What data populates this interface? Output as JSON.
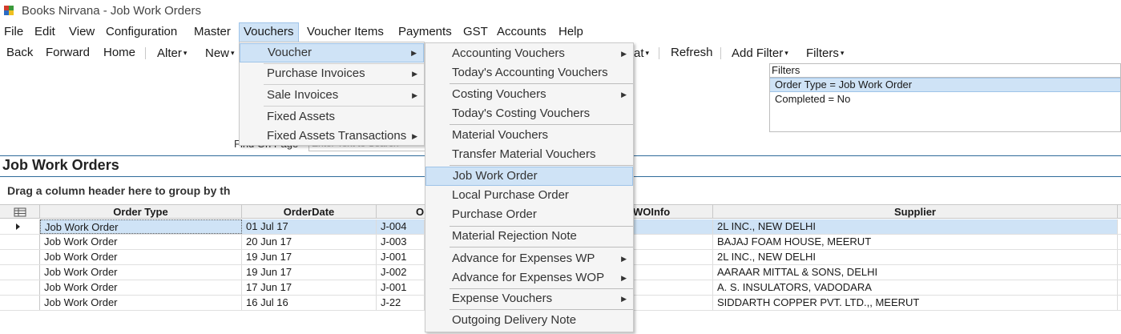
{
  "window": {
    "title": "Books Nirvana - Job Work Orders"
  },
  "menubar": {
    "file": "File",
    "edit": "Edit",
    "view": "View",
    "configuration": "Configuration",
    "master": "Master",
    "vouchers": "Vouchers",
    "voucher_items": "Voucher Items",
    "payments": "Payments",
    "gst": "GST",
    "accounts": "Accounts",
    "help": "Help"
  },
  "toolbar": {
    "back": "Back",
    "forward": "Forward",
    "home": "Home",
    "alter": "Alter",
    "new": "New",
    "format_partial": "at",
    "refresh": "Refresh",
    "add_filter": "Add Filter",
    "filters": "Filters"
  },
  "filters": {
    "label": "Filters",
    "items": [
      "Order Type = Job Work Order",
      "Completed = No"
    ]
  },
  "find": {
    "label": "Find On Page",
    "placeholder": "Enter Text to Search"
  },
  "section": {
    "title": "Job Work Orders",
    "group_hint": "Drag a column header here to group by th"
  },
  "grid": {
    "columns": {
      "order_type": "Order Type",
      "order_date": "OrderDate",
      "order_no": "O",
      "wo_info": "WOInfo",
      "supplier": "Supplier"
    },
    "rows": [
      {
        "order_type": "Job Work Order",
        "order_date": "01 Jul 17",
        "order_no": "J-004",
        "supplier": "2L INC., NEW DELHI"
      },
      {
        "order_type": "Job Work Order",
        "order_date": "20 Jun 17",
        "order_no": "J-003",
        "supplier": "BAJAJ FOAM HOUSE, MEERUT"
      },
      {
        "order_type": "Job Work Order",
        "order_date": "19 Jun 17",
        "order_no": "J-001",
        "supplier": "2L INC., NEW DELHI"
      },
      {
        "order_type": "Job Work Order",
        "order_date": "19 Jun 17",
        "order_no": "J-002",
        "supplier": "AARAAR MITTAL & SONS, DELHI"
      },
      {
        "order_type": "Job Work Order",
        "order_date": "17 Jun 17",
        "order_no": "J-001",
        "supplier": "A. S. INSULATORS, VADODARA"
      },
      {
        "order_type": "Job Work Order",
        "order_date": "16 Jul 16",
        "order_no": "J-22",
        "supplier": "SIDDARTH COPPER PVT. LTD.,, MEERUT"
      }
    ]
  },
  "vouchers_menu": {
    "items": [
      "Voucher",
      "Purchase Invoices",
      "Sale Invoices",
      "Fixed Assets",
      "Fixed Assets Transactions"
    ]
  },
  "voucher_submenu": {
    "items": [
      "Accounting Vouchers",
      "Today's Accounting Vouchers",
      "Costing Vouchers",
      "Today's Costing Vouchers",
      "Material Vouchers",
      "Transfer Material Vouchers",
      "Job Work Order",
      "Local Purchase Order",
      "Purchase Order",
      "Material Rejection Note",
      "Advance for Expenses WP",
      "Advance for Expenses WOP",
      "Expense Vouchers",
      "Outgoing Delivery Note"
    ]
  },
  "colors": {
    "selection": "#cfe3f6",
    "selection_border": "#9fc4e8",
    "section_rule": "#2f6b9a"
  }
}
